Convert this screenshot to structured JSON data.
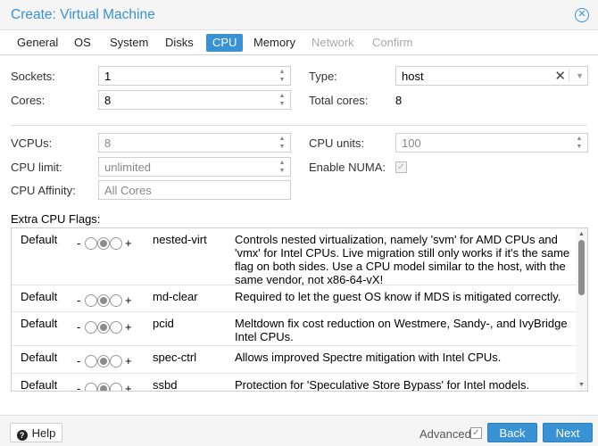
{
  "window": {
    "title": "Create: Virtual Machine",
    "close_icon": "close-circle-icon"
  },
  "tabs": [
    {
      "label": "General",
      "state": "normal"
    },
    {
      "label": "OS",
      "state": "normal"
    },
    {
      "label": "System",
      "state": "normal"
    },
    {
      "label": "Disks",
      "state": "normal"
    },
    {
      "label": "CPU",
      "state": "active"
    },
    {
      "label": "Memory",
      "state": "normal"
    },
    {
      "label": "Network",
      "state": "disabled"
    },
    {
      "label": "Confirm",
      "state": "disabled"
    }
  ],
  "basic": {
    "sockets": {
      "label": "Sockets:",
      "value": "1"
    },
    "cores": {
      "label": "Cores:",
      "value": "8"
    },
    "type": {
      "label": "Type:",
      "value": "host"
    },
    "total_cores": {
      "label": "Total cores:",
      "value": "8"
    }
  },
  "advanced": {
    "vcpus": {
      "label": "VCPUs:",
      "value": "8"
    },
    "cpu_limit": {
      "label": "CPU limit:",
      "placeholder": "unlimited"
    },
    "cpu_affinity": {
      "label": "CPU Affinity:",
      "placeholder": "All Cores"
    },
    "cpu_units": {
      "label": "CPU units:",
      "placeholder": "100"
    },
    "enable_numa": {
      "label": "Enable NUMA:",
      "checked": true
    }
  },
  "flags": {
    "label": "Extra CPU Flags:",
    "rows": [
      {
        "state": "Default",
        "name": "nested-virt",
        "selected": 1,
        "description": "Controls nested virtualization, namely 'svm' for AMD CPUs and 'vmx' for Intel CPUs. Live migration still only works if it's the same flag on both sides. Use a CPU model similar to the host, with the same vendor, not x86-64-vX!"
      },
      {
        "state": "Default",
        "name": "md-clear",
        "selected": 1,
        "description": "Required to let the guest OS know if MDS is mitigated correctly."
      },
      {
        "state": "Default",
        "name": "pcid",
        "selected": 1,
        "description": "Meltdown fix cost reduction on Westmere, Sandy-, and IvyBridge Intel CPUs."
      },
      {
        "state": "Default",
        "name": "spec-ctrl",
        "selected": 1,
        "description": "Allows improved Spectre mitigation with Intel CPUs."
      },
      {
        "state": "Default",
        "name": "ssbd",
        "selected": 1,
        "description": "Protection for 'Speculative Store Bypass' for Intel models."
      }
    ],
    "minus": "-",
    "plus": "+"
  },
  "footer": {
    "help_label": "Help",
    "help_icon": "question-circle-icon",
    "advanced_label": "Advanced",
    "advanced_checked": true,
    "back_label": "Back",
    "next_label": "Next"
  },
  "colors": {
    "accent": "#3892d4"
  }
}
